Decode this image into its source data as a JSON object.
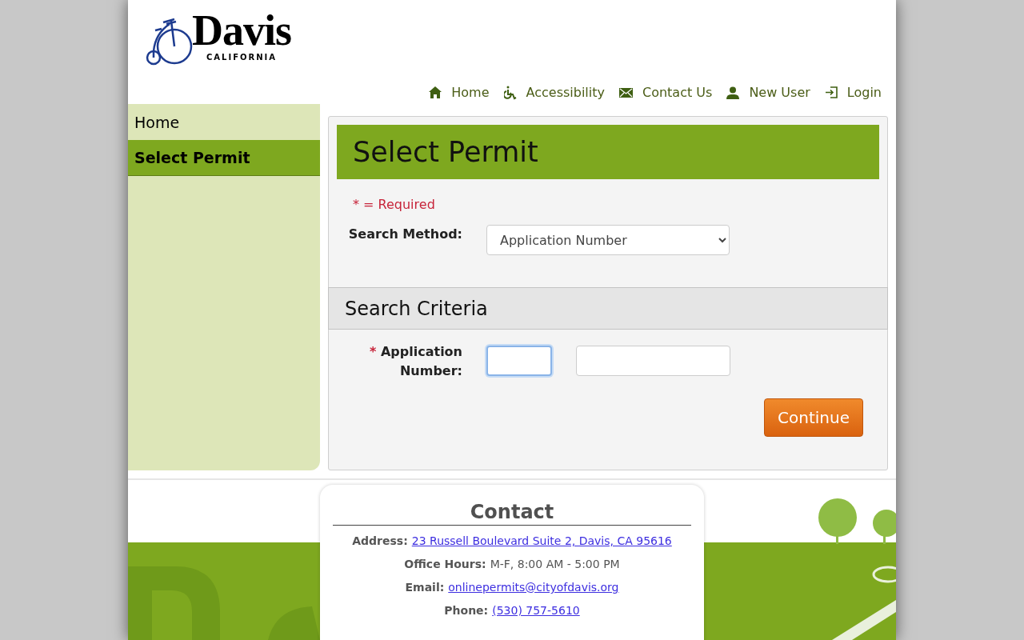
{
  "logo": {
    "name": "Davis",
    "subtitle": "CALIFORNIA"
  },
  "nav": [
    {
      "label": "Home",
      "kind": "home"
    },
    {
      "label": "Accessibility",
      "kind": "accessibility"
    },
    {
      "label": "Contact Us",
      "kind": "mail"
    },
    {
      "label": "New User",
      "kind": "user"
    },
    {
      "label": "Login",
      "kind": "login"
    }
  ],
  "sidebar": {
    "items": [
      {
        "label": "Home",
        "selected": false
      },
      {
        "label": "Select Permit",
        "selected": true
      }
    ]
  },
  "form": {
    "title": "Select Permit",
    "required_note": "* = Required",
    "search_method": {
      "label": "Search Method:",
      "value": "Application Number"
    },
    "section_title": "Search Criteria",
    "application_number": {
      "required_mark": "*",
      "label": "Application Number:",
      "fields": [
        {
          "focused": true
        },
        {
          "focused": false
        }
      ]
    },
    "submit": "Continue"
  },
  "contact": {
    "title": "Contact",
    "lines": [
      {
        "label": "Address:",
        "value": "23 Russell Boulevard Suite 2, Davis, CA 95616",
        "kind": "link"
      },
      {
        "label": "Office Hours:",
        "value": "M-F, 8:00 AM - 5:00 PM",
        "kind": "text"
      },
      {
        "label": "Email:",
        "value": "onlinepermits@cityofdavis.org",
        "kind": "link"
      },
      {
        "label": "Phone:",
        "value": "(530) 757-5610",
        "kind": "link"
      }
    ]
  }
}
